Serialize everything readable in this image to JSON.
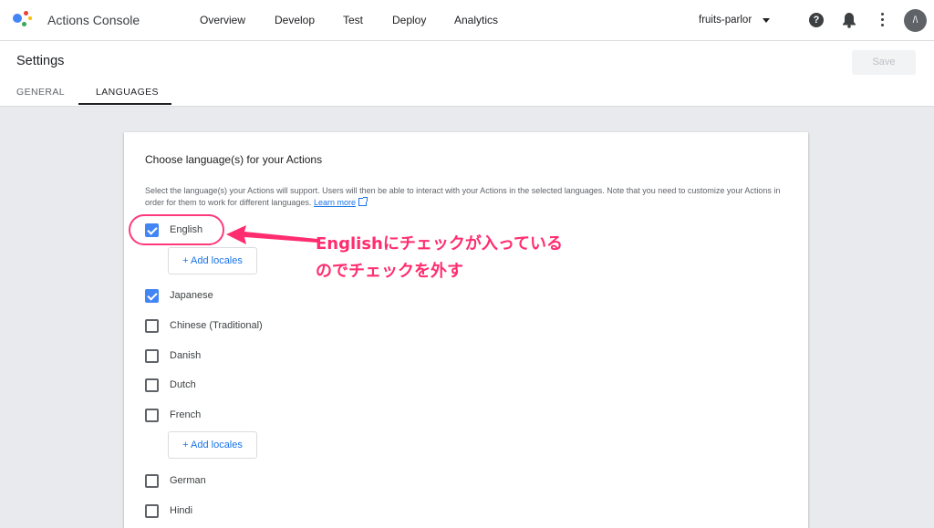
{
  "app": {
    "title": "Actions Console",
    "logo_colors": [
      "#4285f4",
      "#ea4335",
      "#fbbc05",
      "#34a853"
    ]
  },
  "nav": {
    "items": [
      "Overview",
      "Develop",
      "Test",
      "Deploy",
      "Analytics"
    ]
  },
  "header": {
    "project": "fruits-parlor",
    "help_glyph": "?",
    "avatar_initials": "/\\"
  },
  "settings": {
    "title": "Settings",
    "save_label": "Save",
    "tabs": [
      "GENERAL",
      "LANGUAGES"
    ],
    "active_tab": "LANGUAGES"
  },
  "card": {
    "title": "Choose language(s) for your Actions",
    "description": "Select the language(s) your Actions will support. Users will then be able to interact with your Actions in the selected languages. Note that you need to customize your Actions in order for them to work for different languages.",
    "learn_more": "Learn more",
    "add_locales_label": "+ Add locales",
    "languages": [
      {
        "label": "English",
        "checked": true
      },
      {
        "label": "Japanese",
        "checked": true
      },
      {
        "label": "Chinese (Traditional)",
        "checked": false
      },
      {
        "label": "Danish",
        "checked": false
      },
      {
        "label": "Dutch",
        "checked": false
      },
      {
        "label": "French",
        "checked": false
      },
      {
        "label": "German",
        "checked": false
      },
      {
        "label": "Hindi",
        "checked": false
      }
    ]
  },
  "annotation": {
    "line1": "Englishにチェックが入っている",
    "line2": "のでチェックを外す",
    "color": "#ff2d6f"
  }
}
